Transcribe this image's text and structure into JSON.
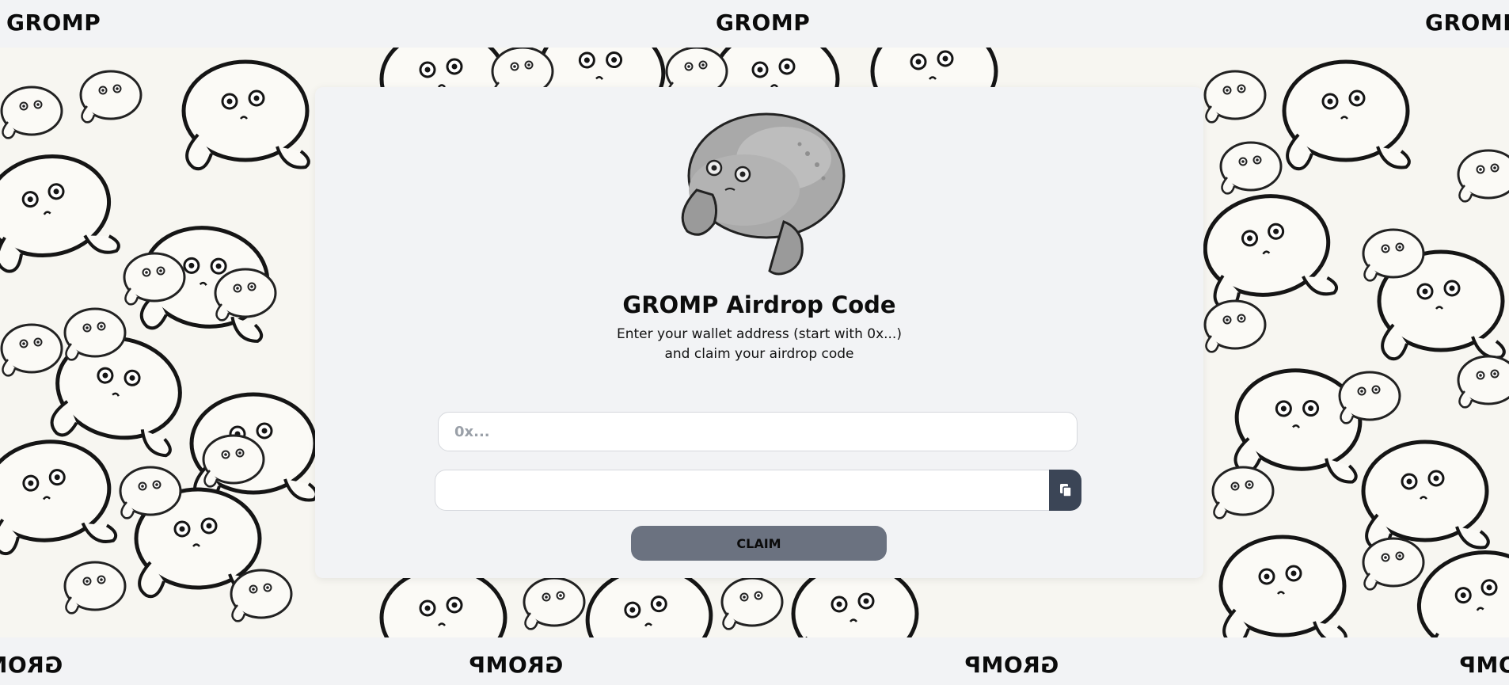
{
  "brand": {
    "word": "GROMP"
  },
  "card": {
    "title": "GROMP Airdrop Code",
    "subtitle_line1": "Enter your wallet address (start with 0x...)",
    "subtitle_line2": "and claim your airdrop code",
    "wallet_input": {
      "placeholder": "0x...",
      "value": ""
    },
    "code_field": {
      "value": ""
    },
    "copy_icon": "copy-icon",
    "claim_label": "CLAIM"
  },
  "colors": {
    "background": "#f2f3f5",
    "pattern_bg": "#f7f6f1",
    "button_gray": "#6b7280",
    "copy_button": "#3b4556"
  }
}
